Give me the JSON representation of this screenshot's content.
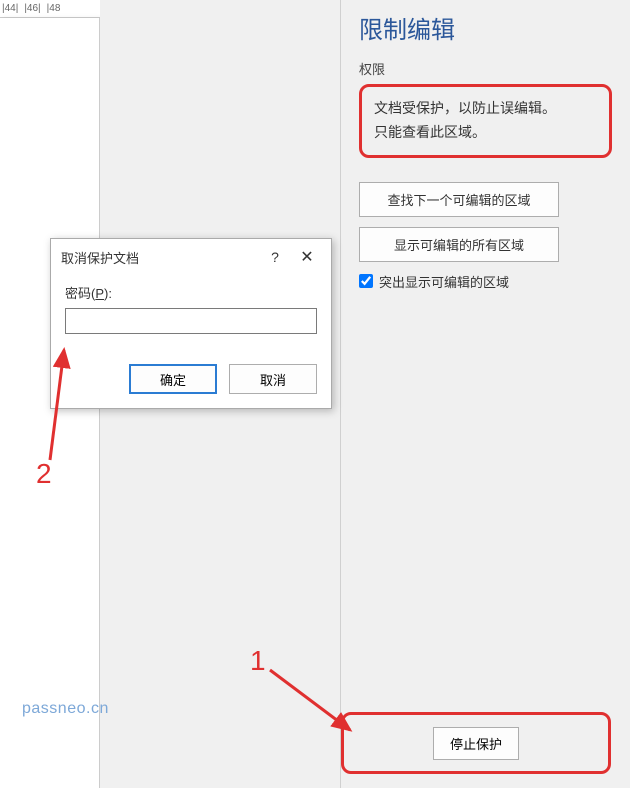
{
  "ruler": {
    "marks": [
      "|44|",
      "|46|",
      "|48"
    ]
  },
  "panel": {
    "title": "限制编辑",
    "section_label": "权限",
    "info_line1": "文档受保护，以防止误编辑。",
    "info_line2": "只能查看此区域。",
    "btn_find_next": "查找下一个可编辑的区域",
    "btn_show_all": "显示可编辑的所有区域",
    "checkbox_label": "突出显示可编辑的区域",
    "checkbox_checked": true,
    "btn_stop": "停止保护"
  },
  "dialog": {
    "title": "取消保护文档",
    "help": "?",
    "close": "✕",
    "password_label_pre": "密码(",
    "password_label_u": "P",
    "password_label_post": "):",
    "password_value": "",
    "ok": "确定",
    "cancel": "取消"
  },
  "annotations": {
    "num1": "1",
    "num2": "2",
    "arrow_color": "#e03030"
  },
  "watermark": "passneo.cn"
}
